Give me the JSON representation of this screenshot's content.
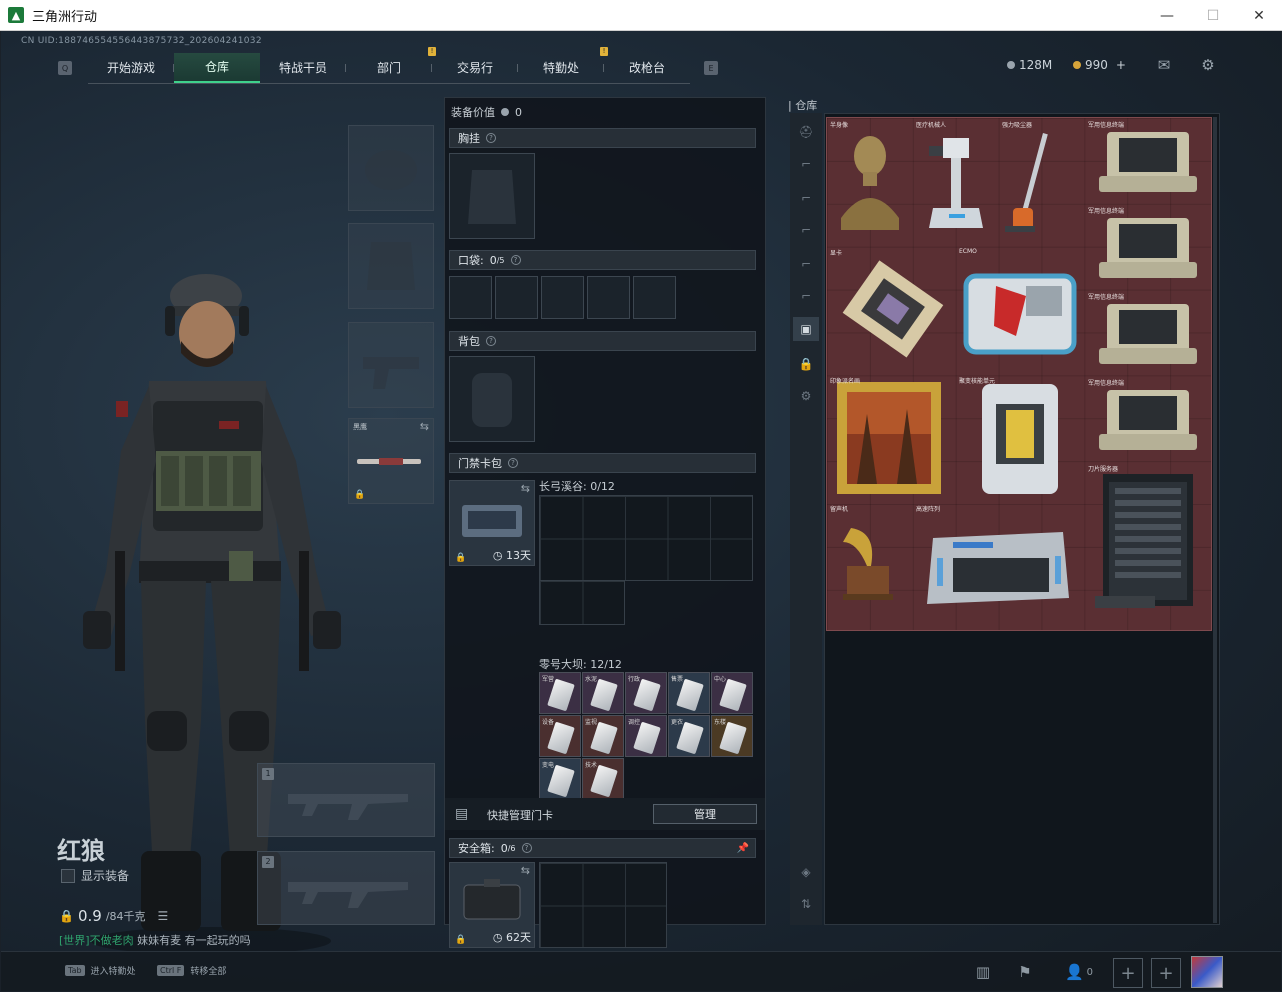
{
  "window": {
    "title": "三角洲行动",
    "minimize": "—",
    "maximize": "☐",
    "close": "✕"
  },
  "uid": "CN UID:1887465545564438757​32_202604241032",
  "nav": {
    "left_key": "Q",
    "right_key": "E",
    "tabs": [
      {
        "label": "开始游戏",
        "badge": ""
      },
      {
        "label": "仓库",
        "badge": ""
      },
      {
        "label": "特战干员",
        "badge": ""
      },
      {
        "label": "部门",
        "badge": "!"
      },
      {
        "label": "交易行",
        "badge": ""
      },
      {
        "label": "特勤处",
        "badge": "!"
      },
      {
        "label": "改枪台",
        "badge": ""
      }
    ]
  },
  "currency": {
    "silver": "128M",
    "gold": "990",
    "gold_plus": "+"
  },
  "character": {
    "name": "红狼",
    "show_equipment": "显示装备",
    "weight": "0.9",
    "weight_max": "/84千克",
    "melee_label": "黑鹰",
    "weapon_slot_1": "1",
    "weapon_slot_2": "2"
  },
  "chat": {
    "channel": "[世界]",
    "user": "不做老肉",
    "message": "妹妹有麦 有一起玩的吗"
  },
  "equipment": {
    "value_label": "装备价值",
    "value": "0",
    "chest_rig": "胸挂",
    "pockets": "口袋:",
    "pockets_count": "0",
    "pockets_max": "/5",
    "backpack": "背包",
    "keycard_pack": "门禁卡包",
    "keycard_days": "13天",
    "map1": "长弓溪谷: 0/12",
    "map2": "零号大坝: 12/12",
    "quick_manage": "快捷管理门卡",
    "manage_btn": "管理",
    "safe_box": "安全箱:",
    "safe_count": "0",
    "safe_max": "/6",
    "safe_days": "62天"
  },
  "keycards": [
    {
      "tag": "军营",
      "color": "#3b2f44"
    },
    {
      "tag": "水泥",
      "color": "#3b2f44"
    },
    {
      "tag": "行政",
      "color": "#3b2f44"
    },
    {
      "tag": "售票",
      "color": "#2c3a4a"
    },
    {
      "tag": "中心",
      "color": "#3b2f44"
    },
    {
      "tag": "设备",
      "color": "#4a2f2f"
    },
    {
      "tag": "监视",
      "color": "#4a2f2f"
    },
    {
      "tag": "调控",
      "color": "#3b2f44"
    },
    {
      "tag": "更衣",
      "color": "#2c3a4a"
    },
    {
      "tag": "东楼",
      "color": "#4b3a24"
    },
    {
      "tag": "变电",
      "color": "#2c3a4a"
    },
    {
      "tag": "技术",
      "color": "#4a2f2f"
    }
  ],
  "warehouse": {
    "title": "仓库",
    "items": [
      {
        "label": "半身像",
        "icon": "bust"
      },
      {
        "label": "医疗机械人",
        "icon": "robot"
      },
      {
        "label": "强力吸尘器",
        "icon": "vacuum"
      },
      {
        "label": "军用信息终端",
        "icon": "terminal"
      },
      {
        "label": "军用信息终端",
        "icon": "terminal"
      },
      {
        "label": "显卡",
        "icon": "gpu"
      },
      {
        "label": "ECMO",
        "icon": "ecmo"
      },
      {
        "label": "军用信息终端",
        "icon": "terminal"
      },
      {
        "label": "印象派名画",
        "icon": "painting"
      },
      {
        "label": "聚变核能单元",
        "icon": "fusion"
      },
      {
        "label": "军用信息终端",
        "icon": "terminal"
      },
      {
        "label": "刀片服务器",
        "icon": "server"
      },
      {
        "label": "留声机",
        "icon": "gramophone"
      },
      {
        "label": "高速阵列",
        "icon": "array"
      }
    ]
  },
  "bottom": {
    "hint1_key": "Tab",
    "hint1": "进入特勤处",
    "hint2_key": "Ctrl F",
    "hint2": "转移全部",
    "party_count": "0"
  }
}
